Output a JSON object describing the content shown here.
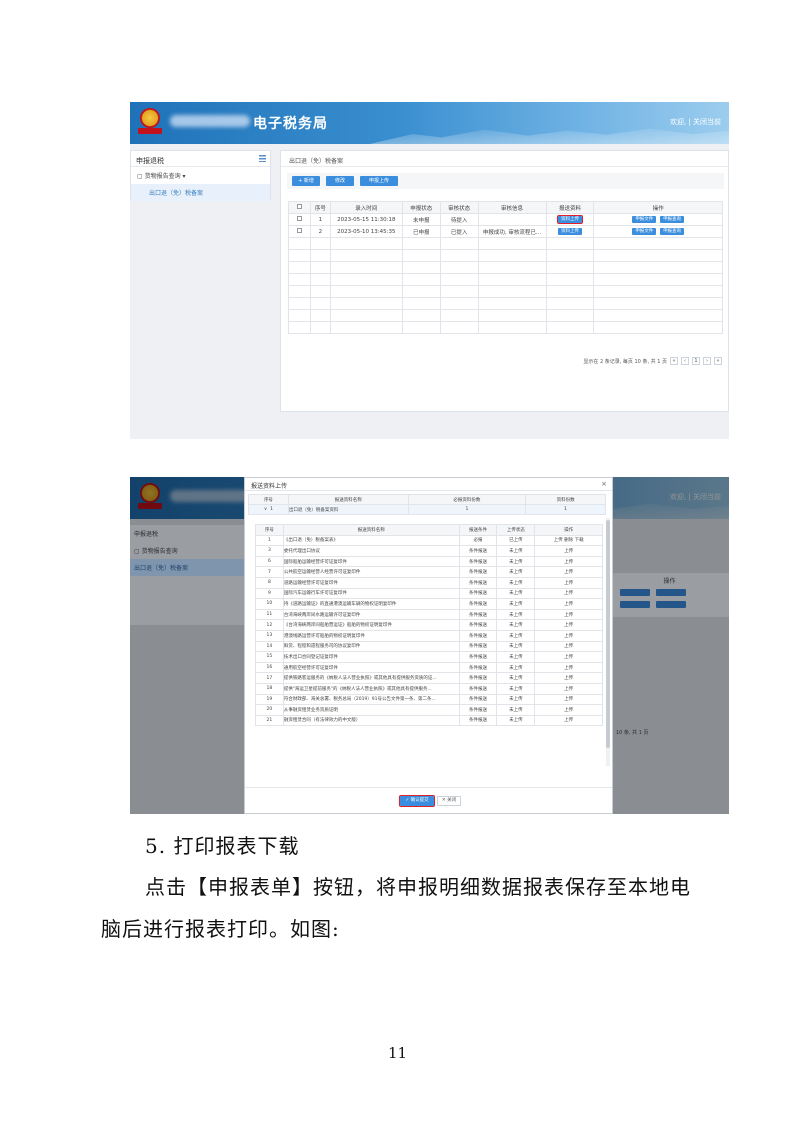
{
  "shot1": {
    "banner_title": "电子税务局",
    "banner_right": "欢迎,  |  关闭当前",
    "sidebar": {
      "header": "申报退税",
      "group": "货物报告查询",
      "item": "出口退（免）税备案"
    },
    "breadcrumb": "出口退（免）税备案",
    "toolbar": {
      "add": "+ 新增",
      "modify": "修改",
      "upload": "申报上传"
    },
    "table": {
      "headers": [
        "",
        "序号",
        "录入时间",
        "申报状态",
        "审核状态",
        "审核信息",
        "报送资料",
        "操作"
      ],
      "rows": [
        {
          "no": "1",
          "time": "2023-05-15 11:30:18",
          "apply": "未申报",
          "audit": "待提入",
          "info": "",
          "send": "资料上传",
          "op1": "申报文件",
          "op2": "申报查询"
        },
        {
          "no": "2",
          "time": "2023-05-10 13:45:35",
          "apply": "已申报",
          "audit": "已提入",
          "info": "申报成功, 审核流程已...",
          "send": "资料上传",
          "op1": "申报文件",
          "op2": "申报查询"
        }
      ]
    },
    "pager": {
      "summary": "显示在 2 条记录, 每页 10 条, 共 1 页",
      "page": "1"
    }
  },
  "shot2": {
    "modal_title": "报送资料上传",
    "outer_headers": [
      "序号",
      "报送资料名称",
      "必报资料份数",
      "资料份数"
    ],
    "outer_row": {
      "no": "1",
      "name": "出口退（免）税备案资料",
      "req": "1",
      "count": "1"
    },
    "inner_headers": [
      "序号",
      "报送资料名称",
      "报送条件",
      "上传状态",
      "操作"
    ],
    "inner_rows": [
      {
        "no": "1",
        "name": "《出口退（免）税备案表》",
        "cond": "必报",
        "status": "已上传",
        "op": "上传  删除  下载"
      },
      {
        "no": "3",
        "name": "委托代理出口协议",
        "cond": "条件报送",
        "status": "未上传",
        "op": "上传"
      },
      {
        "no": "6",
        "name": "国际船舶运输经营许可证复印件",
        "cond": "条件报送",
        "status": "未上传",
        "op": "上传"
      },
      {
        "no": "7",
        "name": "公共航空运输经营人经营许可证复印件",
        "cond": "条件报送",
        "status": "未上传",
        "op": "上传"
      },
      {
        "no": "8",
        "name": "道路运输经营许可证复印件",
        "cond": "条件报送",
        "status": "未上传",
        "op": "上传"
      },
      {
        "no": "9",
        "name": "国际汽车运输行车许可证复印件",
        "cond": "条件报送",
        "status": "未上传",
        "op": "上传"
      },
      {
        "no": "10",
        "name": "持《道路运输证》的直通港澳运输车辆的物权证明复印件",
        "cond": "条件报送",
        "status": "未上传",
        "op": "上传"
      },
      {
        "no": "11",
        "name": "台湾海峡两岸间水路运输许可证复印件",
        "cond": "条件报送",
        "status": "未上传",
        "op": "上传"
      },
      {
        "no": "12",
        "name": "《台湾海峡两岸间船舶营运证》船舶的物权证明复印件",
        "cond": "条件报送",
        "status": "未上传",
        "op": "上传"
      },
      {
        "no": "13",
        "name": "港澳线路运营许可船舶的物权证明复印件",
        "cond": "条件报送",
        "status": "未上传",
        "op": "上传"
      },
      {
        "no": "14",
        "name": "鲜货、程程和遗程服务司的协议复印件",
        "cond": "条件报送",
        "status": "未上传",
        "op": "上传"
      },
      {
        "no": "15",
        "name": "技术出口合同登记证复印件",
        "cond": "条件报送",
        "status": "未上传",
        "op": "上传"
      },
      {
        "no": "16",
        "name": "通用航空经营许可证复印件",
        "cond": "条件报送",
        "status": "未上传",
        "op": "上传"
      },
      {
        "no": "17",
        "name": "提供铁路客运服务的《纳税人法人营业执照》或其他具有提供服务资质的证...",
        "cond": "条件报送",
        "status": "未上传",
        "op": "上传"
      },
      {
        "no": "18",
        "name": "提供\"海运卫星提前服务\"的《纳税人法人营业执照》或其他具有提供服务...",
        "cond": "条件报送",
        "status": "未上传",
        "op": "上传"
      },
      {
        "no": "19",
        "name": "符合财政部、海关总署、税务总局（2019）91号公告文件第一条、第二条...",
        "cond": "条件报送",
        "status": "未上传",
        "op": "上传"
      },
      {
        "no": "20",
        "name": "从事融资租赁业务资质证明",
        "cond": "条件报送",
        "status": "未上传",
        "op": "上传"
      },
      {
        "no": "21",
        "name": "融资租赁合同（有法律效力的中文版）",
        "cond": "条件报送",
        "status": "未上传",
        "op": "上传"
      }
    ],
    "confirm": "确认提交",
    "close": "关闭",
    "under_sidebar": {
      "header": "申报退税",
      "group": "货物报告查询",
      "item": "出口退（免）税备案"
    },
    "under_op_header": "操作",
    "under_banner_right": "欢迎,  |  关闭当前",
    "under_pager": "10 条, 共 1 页"
  },
  "doc": {
    "heading": "5. 打印报表下载",
    "para_line1": "点击【申报表单】按钮，将申报明细数据报表保存至本地电",
    "para_line2": "脑后进行报表打印。如图:",
    "page_number": "11"
  }
}
